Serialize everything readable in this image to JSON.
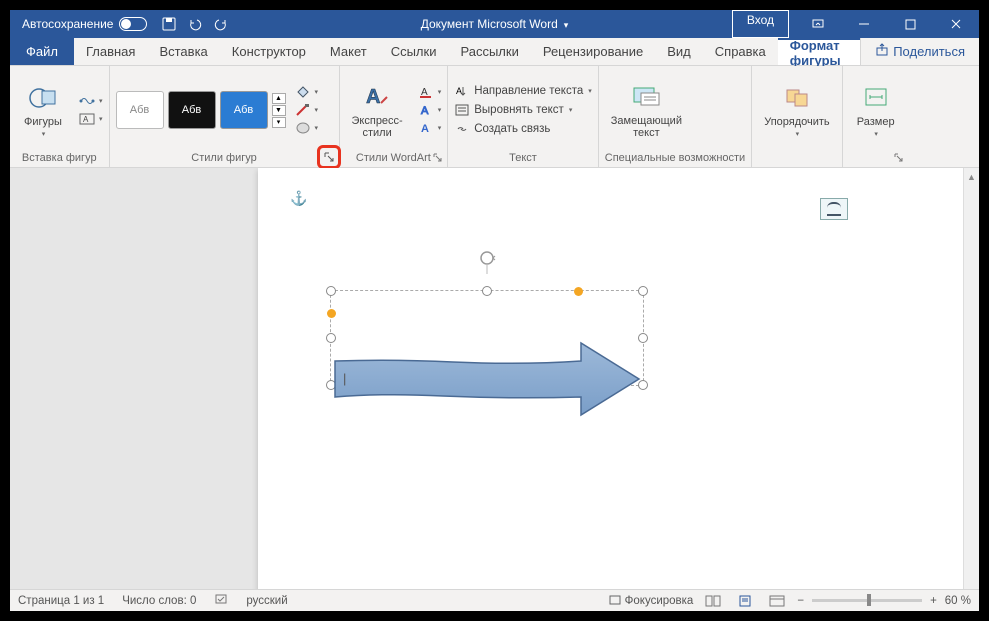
{
  "titlebar": {
    "autosave": "Автосохранение",
    "doc_title": "Документ Microsoft Word",
    "login": "Вход"
  },
  "tabs": {
    "file": "Файл",
    "items": [
      "Главная",
      "Вставка",
      "Конструктор",
      "Макет",
      "Ссылки",
      "Рассылки",
      "Рецензирование",
      "Вид",
      "Справка"
    ],
    "active": "Формат фигуры",
    "share": "Поделиться"
  },
  "ribbon": {
    "g1": {
      "label": "Вставка фигур",
      "shapes_btn": "Фигуры"
    },
    "g2": {
      "label": "Стили фигур",
      "sample": "Абв"
    },
    "g3": {
      "label": "Стили WordArt",
      "express": "Экспресс-\nстили"
    },
    "g4": {
      "label": "Текст",
      "dir": "Направление текста",
      "align": "Выровнять текст",
      "link": "Создать связь"
    },
    "g5": {
      "label": "Специальные возможности",
      "alt": "Замещающий\nтекст"
    },
    "g6": {
      "arrange": "Упорядочить"
    },
    "g7": {
      "size": "Размер"
    }
  },
  "status": {
    "page": "Страница 1 из 1",
    "words": "Число слов: 0",
    "lang": "русский",
    "focus": "Фокусировка",
    "zoom": "60 %"
  }
}
